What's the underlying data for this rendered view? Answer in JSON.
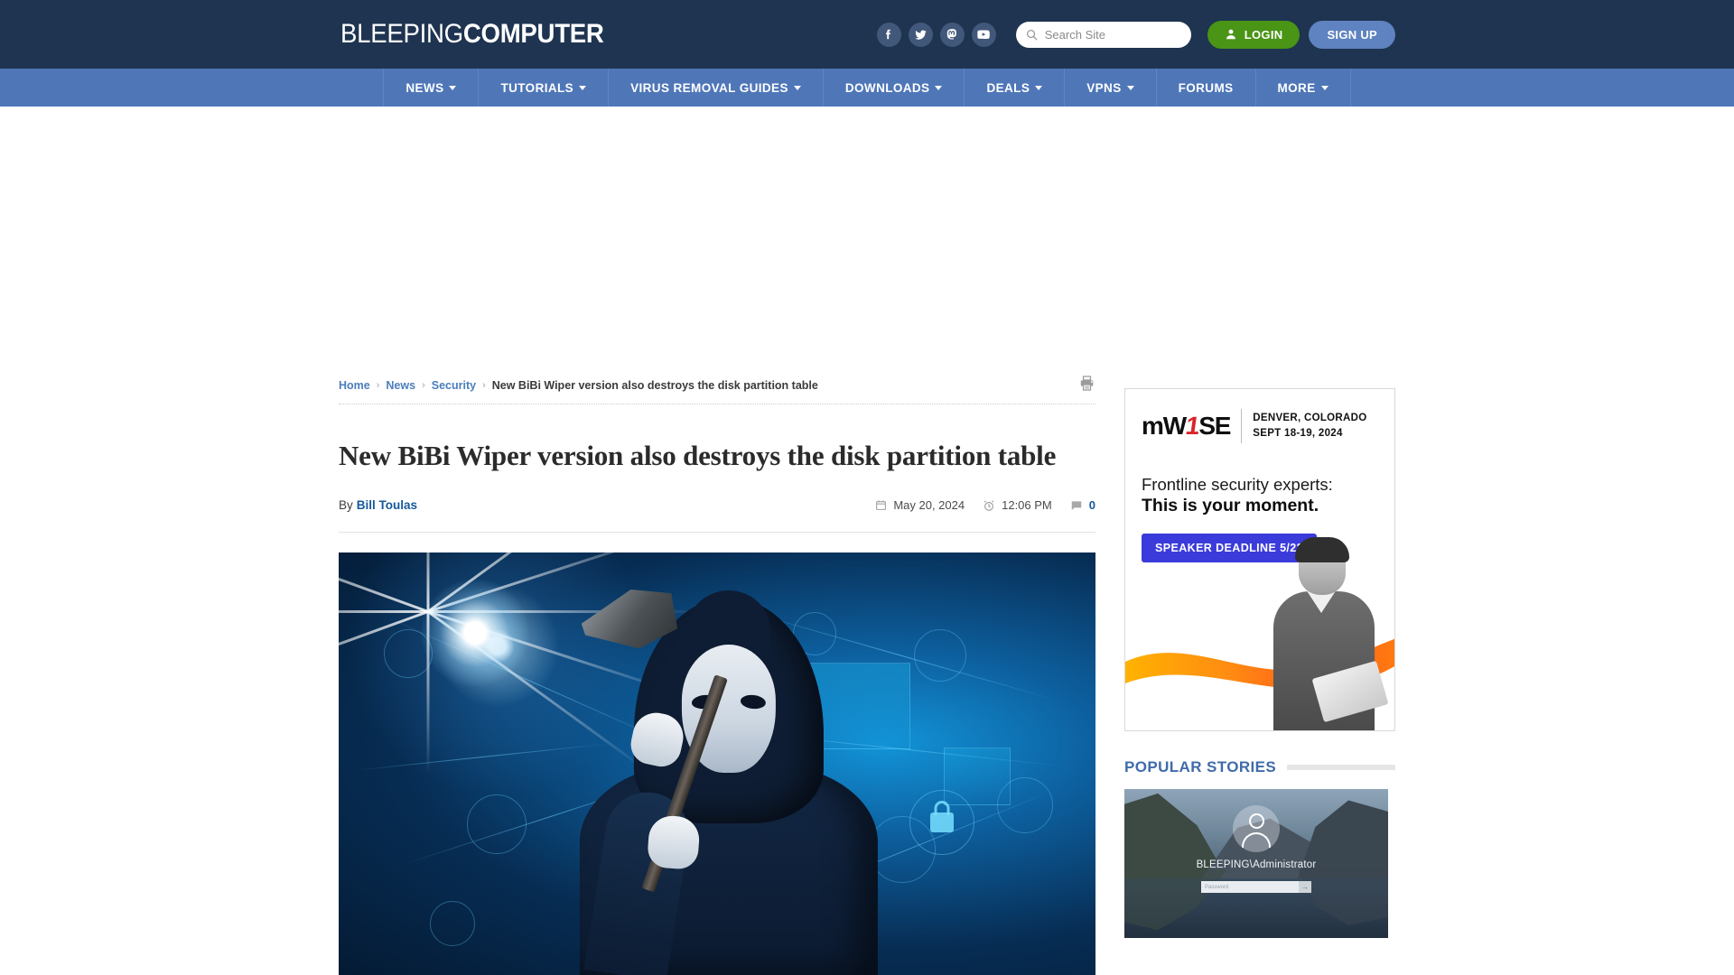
{
  "header": {
    "logo_light": "BLEEPING",
    "logo_bold": "COMPUTER",
    "socials": [
      {
        "name": "facebook-icon",
        "label": "Facebook"
      },
      {
        "name": "twitter-icon",
        "label": "Twitter"
      },
      {
        "name": "mastodon-icon",
        "label": "Mastodon"
      },
      {
        "name": "youtube-icon",
        "label": "YouTube"
      }
    ],
    "search": {
      "placeholder": "Search Site",
      "value": ""
    },
    "login_label": "LOGIN",
    "signup_label": "SIGN UP",
    "colors": {
      "header_bg": "#1e3450",
      "nav_bg": "#4f77b8",
      "login_bg": "#4a9416",
      "signup_bg": "#5f83c0"
    }
  },
  "nav": {
    "items": [
      {
        "label": "NEWS",
        "has_dropdown": true
      },
      {
        "label": "TUTORIALS",
        "has_dropdown": true
      },
      {
        "label": "VIRUS REMOVAL GUIDES",
        "has_dropdown": true
      },
      {
        "label": "DOWNLOADS",
        "has_dropdown": true
      },
      {
        "label": "DEALS",
        "has_dropdown": true
      },
      {
        "label": "VPNS",
        "has_dropdown": true
      },
      {
        "label": "FORUMS",
        "has_dropdown": false
      },
      {
        "label": "MORE",
        "has_dropdown": true
      }
    ]
  },
  "breadcrumb": {
    "home": "Home",
    "news": "News",
    "security": "Security",
    "current": "New BiBi Wiper version also destroys the disk partition table",
    "separator": "›"
  },
  "article": {
    "title": "New BiBi Wiper version also destroys the disk partition table",
    "by_label": "By",
    "author": "Bill Toulas",
    "date": "May 20, 2024",
    "time": "12:06 PM",
    "comment_count": "0",
    "hero_alt": "Hooded figure in a white mask holding an axe over a blue cyber network background"
  },
  "sidebar": {
    "ad": {
      "brand_m": "m",
      "brand_w": "W",
      "brand_one": "1",
      "brand_se": "SE",
      "location": "DENVER, COLORADO",
      "dates": "SEPT 18-19, 2024",
      "headline_line1": "Frontline security experts:",
      "headline_line2": "This is your moment.",
      "cta": "SPEAKER DEADLINE 5/22"
    },
    "popular": {
      "title": "POPULAR STORIES",
      "story_user": "BLEEPING\\Administrator",
      "password_placeholder": "Password",
      "submit_arrow": "→"
    }
  }
}
